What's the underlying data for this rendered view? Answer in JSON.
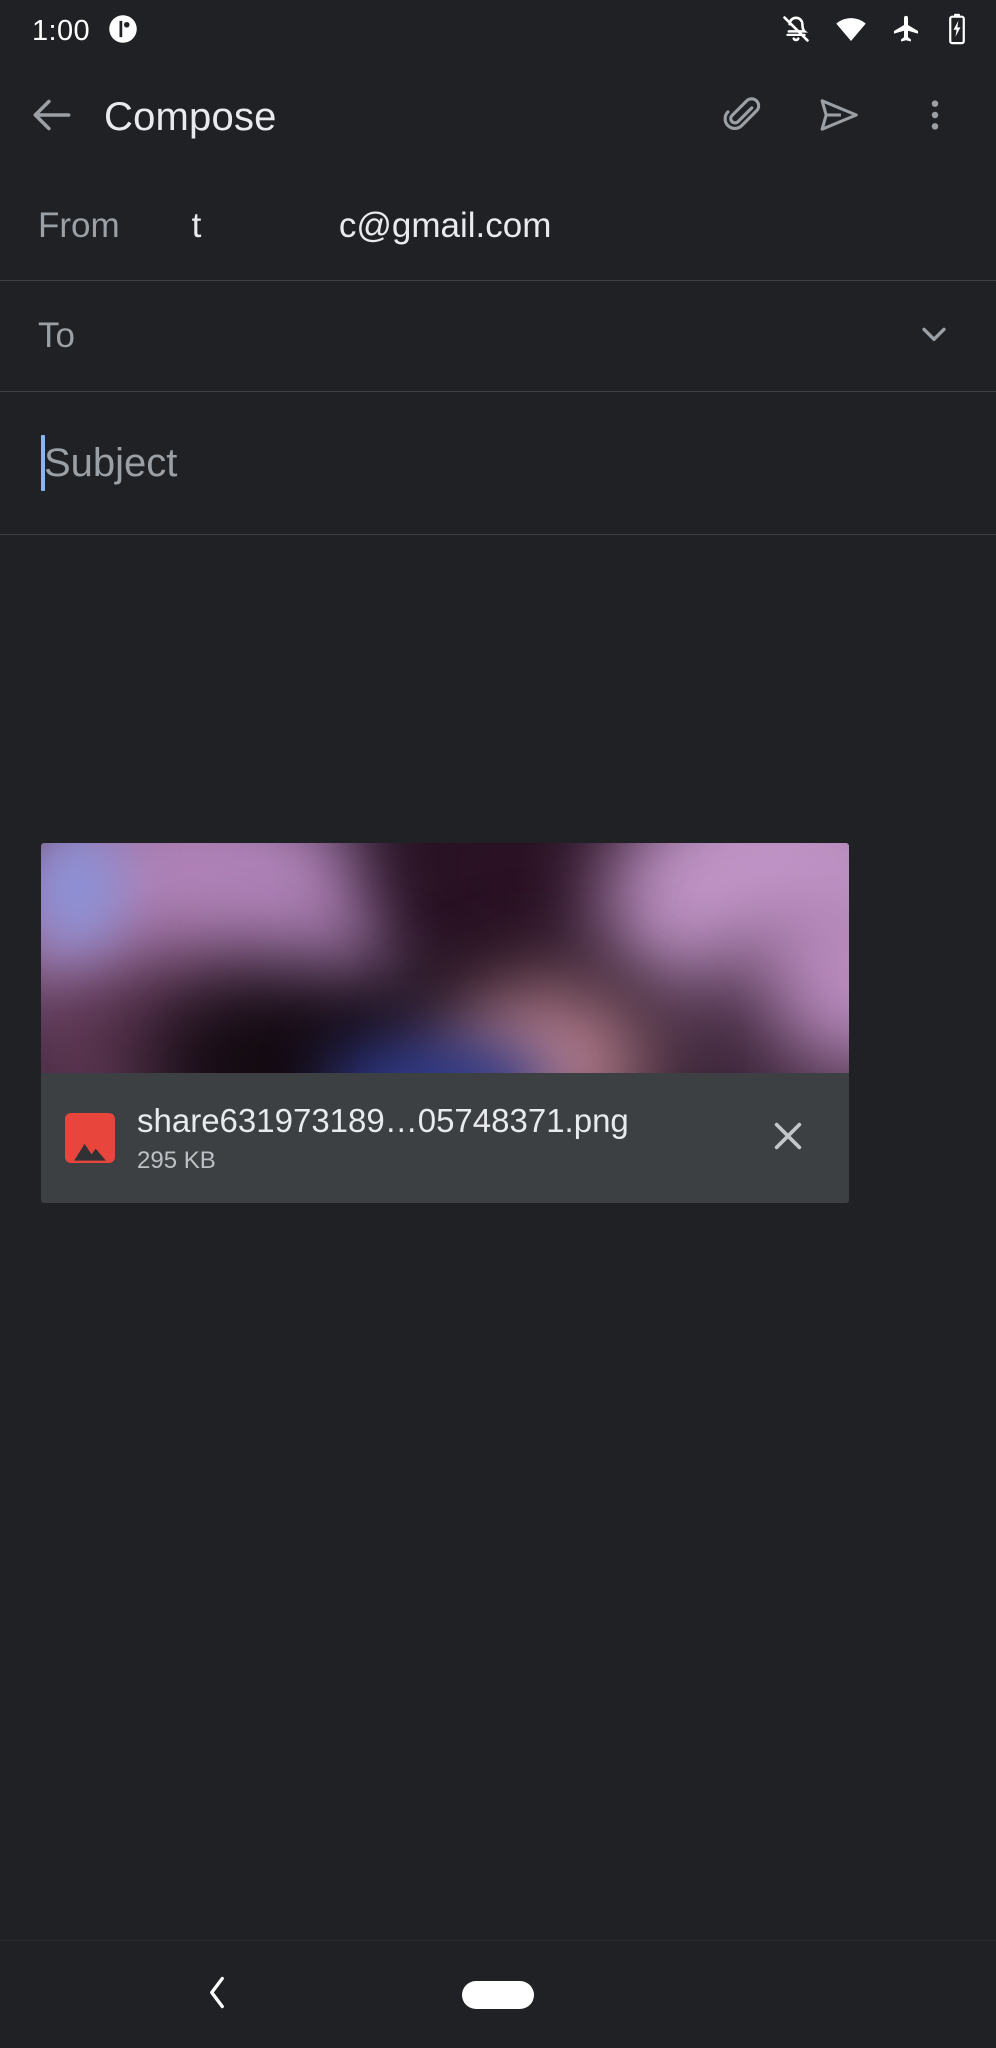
{
  "status_bar": {
    "time": "1:00",
    "icons": [
      "notification-dot-icon",
      "bell-off-icon",
      "wifi-icon",
      "airplane-mode-icon",
      "battery-charging-icon"
    ]
  },
  "toolbar": {
    "back_label": "back-arrow",
    "title": "Compose",
    "attach_label": "Attach file",
    "send_label": "Send",
    "more_label": "More options"
  },
  "compose": {
    "from": {
      "label": "From",
      "value_part1": "t",
      "value_part2": "c@gmail.com"
    },
    "to": {
      "placeholder": "To",
      "value": "",
      "expand_label": "Show Cc/Bcc"
    },
    "subject": {
      "placeholder": "Subject",
      "value": "",
      "focused": true
    },
    "body": {
      "placeholder": "",
      "value": ""
    }
  },
  "attachment": {
    "filename": "share631973189…05748371.png",
    "filesize": "295 KB",
    "type_icon": "image-icon",
    "remove_label": "Remove attachment"
  },
  "nav_bar": {
    "back_label": "Back",
    "home_label": "Home"
  },
  "colors": {
    "background": "#202124",
    "surface": "#3c4043",
    "divider": "#3c4043",
    "text_primary": "#e8eaed",
    "text_secondary": "#9aa0a6",
    "caret": "#8ab4f8",
    "attachment_icon": "#e8453c"
  }
}
